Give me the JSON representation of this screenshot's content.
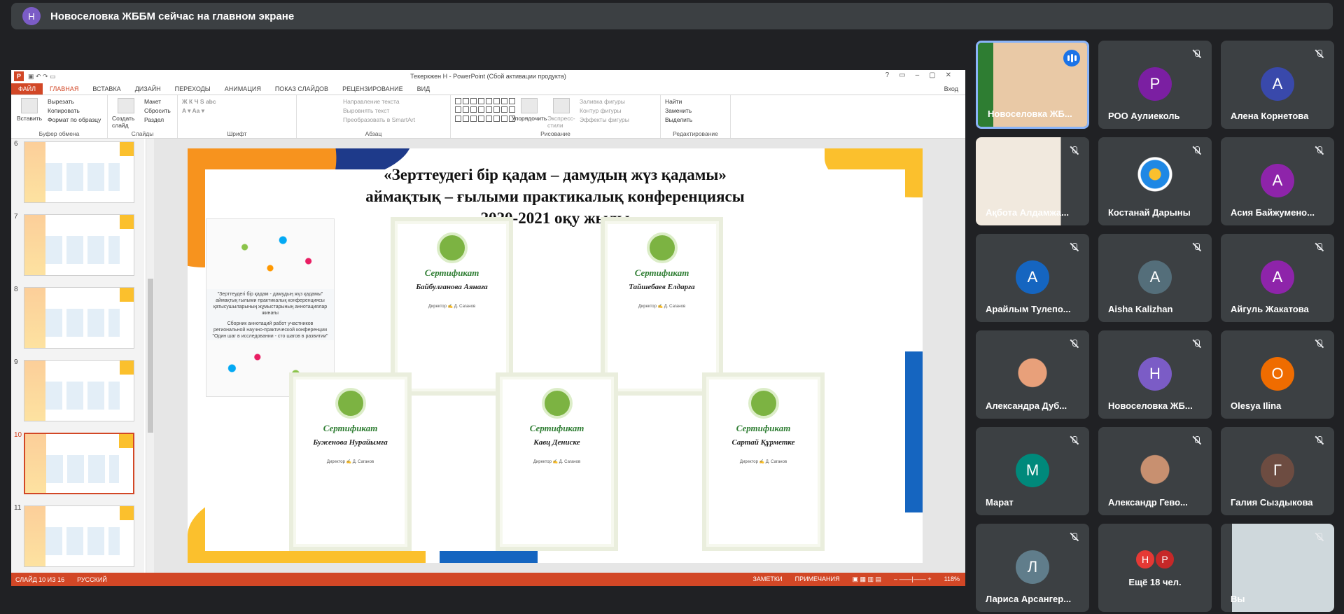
{
  "banner": {
    "initial": "Н",
    "text": "Новоселовка ЖББМ сейчас на главном экране"
  },
  "ppt": {
    "window_title": "Текеркжен Н - PowerPoint (Сбой активации продукта)",
    "tabs": [
      "ФАЙЛ",
      "ГЛАВНАЯ",
      "ВСТАВКА",
      "ДИЗАЙН",
      "ПЕРЕХОДЫ",
      "АНИМАЦИЯ",
      "ПОКАЗ СЛАЙДОВ",
      "РЕЦЕНЗИРОВАНИЕ",
      "ВИД"
    ],
    "login": "Вход",
    "ribbon": {
      "paste": "Вставить",
      "cut": "Вырезать",
      "copy": "Копировать",
      "format_painter": "Формат по образцу",
      "clipboard": "Буфер обмена",
      "new_slide": "Создать слайд",
      "layout": "Макет",
      "reset": "Сбросить",
      "section": "Раздел",
      "slides": "Слайды",
      "font": "Шрифт",
      "text_direction": "Направление текста",
      "align_text": "Выровнять текст",
      "smartart": "Преобразовать в SmartArt",
      "paragraph": "Абзац",
      "arrange": "Упорядочить",
      "express": "Экспресс-стили",
      "fill": "Заливка фигуры",
      "outline": "Контур фигуры",
      "effects": "Эффекты фигуры",
      "drawing": "Рисование",
      "find": "Найти",
      "replace": "Заменить",
      "select": "Выделить",
      "editing": "Редактирование"
    },
    "thumb_numbers": [
      "6",
      "7",
      "8",
      "9",
      "10",
      "11"
    ],
    "slide_title": "«Зерттеудегі бір қадам – дамудың жүз қадамы» аймақтық – ғылыми практикалық конференциясы 2020-2021 оқу жылы",
    "book": {
      "line1": "\"Зерттеудегі бір қадам - дамудың жүз қадамы\" аймақтық ғылыми практикалық конференциясы қатысушыларының жұмыстарының аннотациялар жинағы",
      "line2": "Сборник аннотаций работ участников региональной научно-практической конференции \"Один шаг в исследовании - сто шагов в развитии\""
    },
    "cert_title": "Сертификат",
    "certs": [
      "Байбулганова Аянаға",
      "Тайшебаев Елдарға",
      "Буженова Нурайымға",
      "Кавц Дениске",
      "Сартай Құрметке"
    ],
    "cert_director": "Директор",
    "cert_signer": "Д. Саганов",
    "status_left": "СЛАЙД 10 ИЗ 16",
    "status_lang": "РУССКИЙ",
    "notes": "ЗАМЕТКИ",
    "comments": "ПРИМЕЧАНИЯ",
    "zoom": "118%"
  },
  "participants": [
    {
      "name": "Новоселовка ЖБ...",
      "type": "photo",
      "active": true
    },
    {
      "name": "РОО Аулиеколь",
      "initial": "Р",
      "color": "#7b1fa2"
    },
    {
      "name": "Алена Корнетова",
      "initial": "А",
      "color": "#3949ab"
    },
    {
      "name": "Ақбота Алдамжа...",
      "type": "photo"
    },
    {
      "name": "Костанай Дарыны",
      "type": "logo"
    },
    {
      "name": "Асия Байжумено...",
      "initial": "А",
      "color": "#8e24aa"
    },
    {
      "name": "Арайлым Тулепо...",
      "initial": "А",
      "color": "#1565c0"
    },
    {
      "name": "Aisha Kalizhan",
      "initial": "А",
      "color": "#546e7a"
    },
    {
      "name": "Айгуль Жакатова",
      "initial": "А",
      "color": "#8e24aa"
    },
    {
      "name": "Александра Дуб...",
      "type": "photo"
    },
    {
      "name": "Новоселовка ЖБ...",
      "initial": "Н",
      "color": "#7b5cc6"
    },
    {
      "name": "Olesya Ilina",
      "initial": "О",
      "color": "#ef6c00"
    },
    {
      "name": "Марат",
      "initial": "М",
      "color": "#00897b"
    },
    {
      "name": "Александр Гево...",
      "type": "photo"
    },
    {
      "name": "Галия Сыздыкова",
      "initial": "Г",
      "color": "#6d4c41"
    },
    {
      "name": "Лариса Арсангер...",
      "initial": "Л",
      "color": "#607d8b"
    },
    {
      "name": "Ещё 18 чел.",
      "type": "more"
    },
    {
      "name": "Вы",
      "type": "photo"
    }
  ]
}
